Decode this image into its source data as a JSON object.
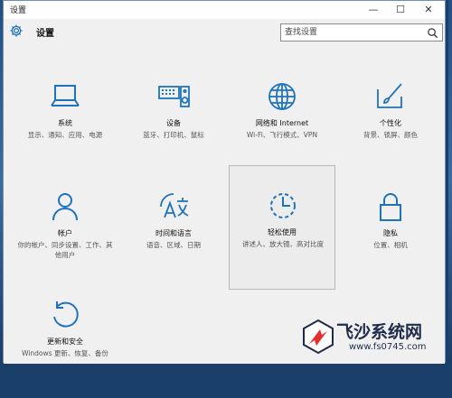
{
  "window": {
    "title": "设置",
    "minimize": "—",
    "maximize": "☐",
    "close": "✕"
  },
  "header": {
    "title": "设置",
    "search_placeholder": "查找设置"
  },
  "tiles": [
    {
      "label": "系统",
      "desc": "显示、通知、应用、电源",
      "icon": "laptop-icon"
    },
    {
      "label": "设备",
      "desc": "蓝牙、打印机、鼠标",
      "icon": "keyboard-speaker-icon"
    },
    {
      "label": "网络和 Internet",
      "desc": "Wi-Fi、飞行模式、VPN",
      "icon": "globe-icon"
    },
    {
      "label": "个性化",
      "desc": "背景、锁屏、颜色",
      "icon": "paintbrush-icon"
    },
    {
      "label": "帐户",
      "desc": "你的帐户、同步设置、工作、其他用户",
      "icon": "person-icon"
    },
    {
      "label": "时间和语言",
      "desc": "语音、区域、日期",
      "icon": "time-language-icon"
    },
    {
      "label": "轻松使用",
      "desc": "讲述人、放大镜、高对比度",
      "icon": "ease-of-access-icon"
    },
    {
      "label": "隐私",
      "desc": "位置、相机",
      "icon": "lock-icon"
    },
    {
      "label": "更新和安全",
      "desc": "Windows 更新、恢复、备份",
      "icon": "update-icon"
    }
  ],
  "watermark": {
    "title": "飞沙系统网",
    "url": "www.fs0745.com"
  },
  "colors": {
    "accent": "#1e73be",
    "background": "#f0f0f0"
  }
}
